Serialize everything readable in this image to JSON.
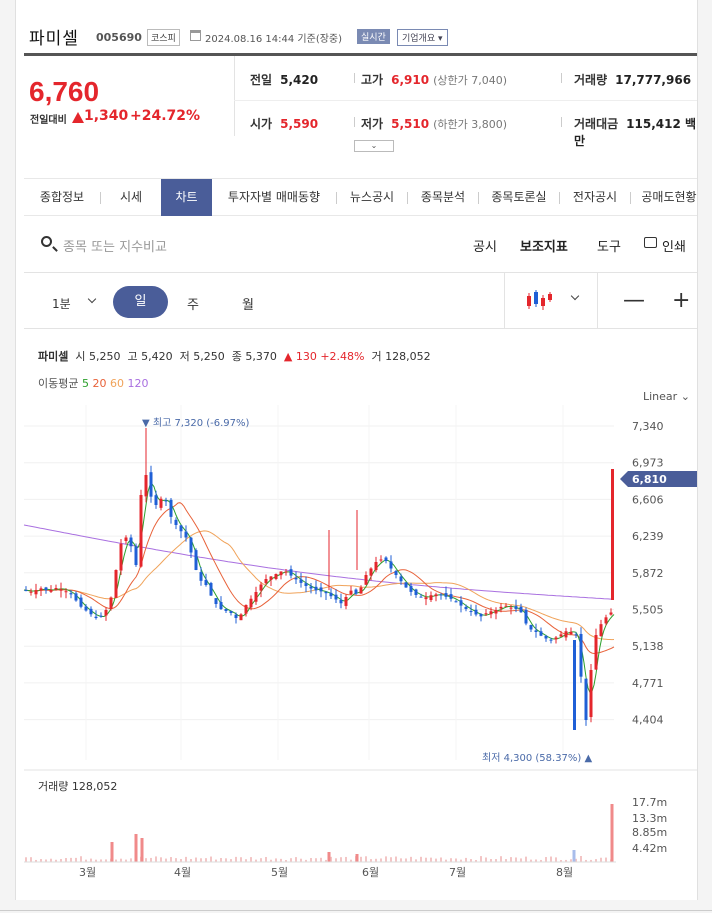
{
  "header": {
    "name": "파미셀",
    "code": "005690",
    "market": "코스피",
    "datetime": "2024.08.16 14:44 기준(장중)",
    "realtime": "실시간",
    "company_info": "기업개요"
  },
  "price": {
    "current": "6,760",
    "change_label": "전일대비",
    "change": "1,340",
    "change_pct": "+24.72%",
    "prev_close_label": "전일",
    "prev_close": "5,420",
    "open_label": "시가",
    "open": "5,590",
    "high_label": "고가",
    "high": "6,910",
    "upper_limit": "(상한가 7,040)",
    "low_label": "저가",
    "low": "5,510",
    "lower_limit": "(하한가 3,800)",
    "volume_label": "거래량",
    "volume": "17,777,966",
    "amount_label": "거래대금",
    "amount": "115,412 백만"
  },
  "tabs": [
    "종합정보",
    "시세",
    "차트",
    "투자자별 매매동향",
    "뉴스공시",
    "종목분석",
    "종목토론실",
    "전자공시",
    "공매도현황"
  ],
  "active_tab": "차트",
  "toolbar": {
    "search_placeholder": "종목 또는 지수비교",
    "disclosure": "공시",
    "indicators": "보조지표",
    "tools": "도구",
    "print": "인쇄"
  },
  "periods": {
    "minute": "1분",
    "day": "일",
    "week": "주",
    "month": "월",
    "zoom_out": "—",
    "zoom_in": "+"
  },
  "legend": {
    "name": "파미셀",
    "open_label": "시",
    "open": "5,250",
    "high_label": "고",
    "high": "5,420",
    "low_label": "저",
    "low": "5,250",
    "close_label": "종",
    "close": "5,370",
    "change": "▲ 130 +2.48%",
    "volume_label": "거",
    "volume": "128,052"
  },
  "ma_legend": {
    "label": "이동평균",
    "ma5": "5",
    "ma20": "20",
    "ma60": "60",
    "ma120": "120",
    "colors": {
      "ma5": "#2ca02c",
      "ma20": "#e8623a",
      "ma60": "#f0a35a",
      "ma120": "#a970e0"
    }
  },
  "scale_label": "Linear",
  "volume_label": "거래량 128,052",
  "chart_data": {
    "type": "candlestick",
    "y_ticks": [
      "7,340",
      "6,973",
      "6,606",
      "6,239",
      "5,872",
      "5,505",
      "5,138",
      "4,771",
      "4,404"
    ],
    "ylim": [
      4300,
      7500
    ],
    "current_price_tag": "6,810",
    "max_annotation": "▼ 최고 7,320 (-6.97%)",
    "min_annotation": "최저 4,300 (58.37%) ▲",
    "volume_ticks": [
      "17.7m",
      "13.3m",
      "8.85m",
      "4.42m"
    ],
    "x_labels": [
      "3월",
      "4월",
      "5월",
      "6월",
      "7월",
      "8월"
    ],
    "up_color": "#e4262c",
    "down_color": "#1f5fd6"
  }
}
